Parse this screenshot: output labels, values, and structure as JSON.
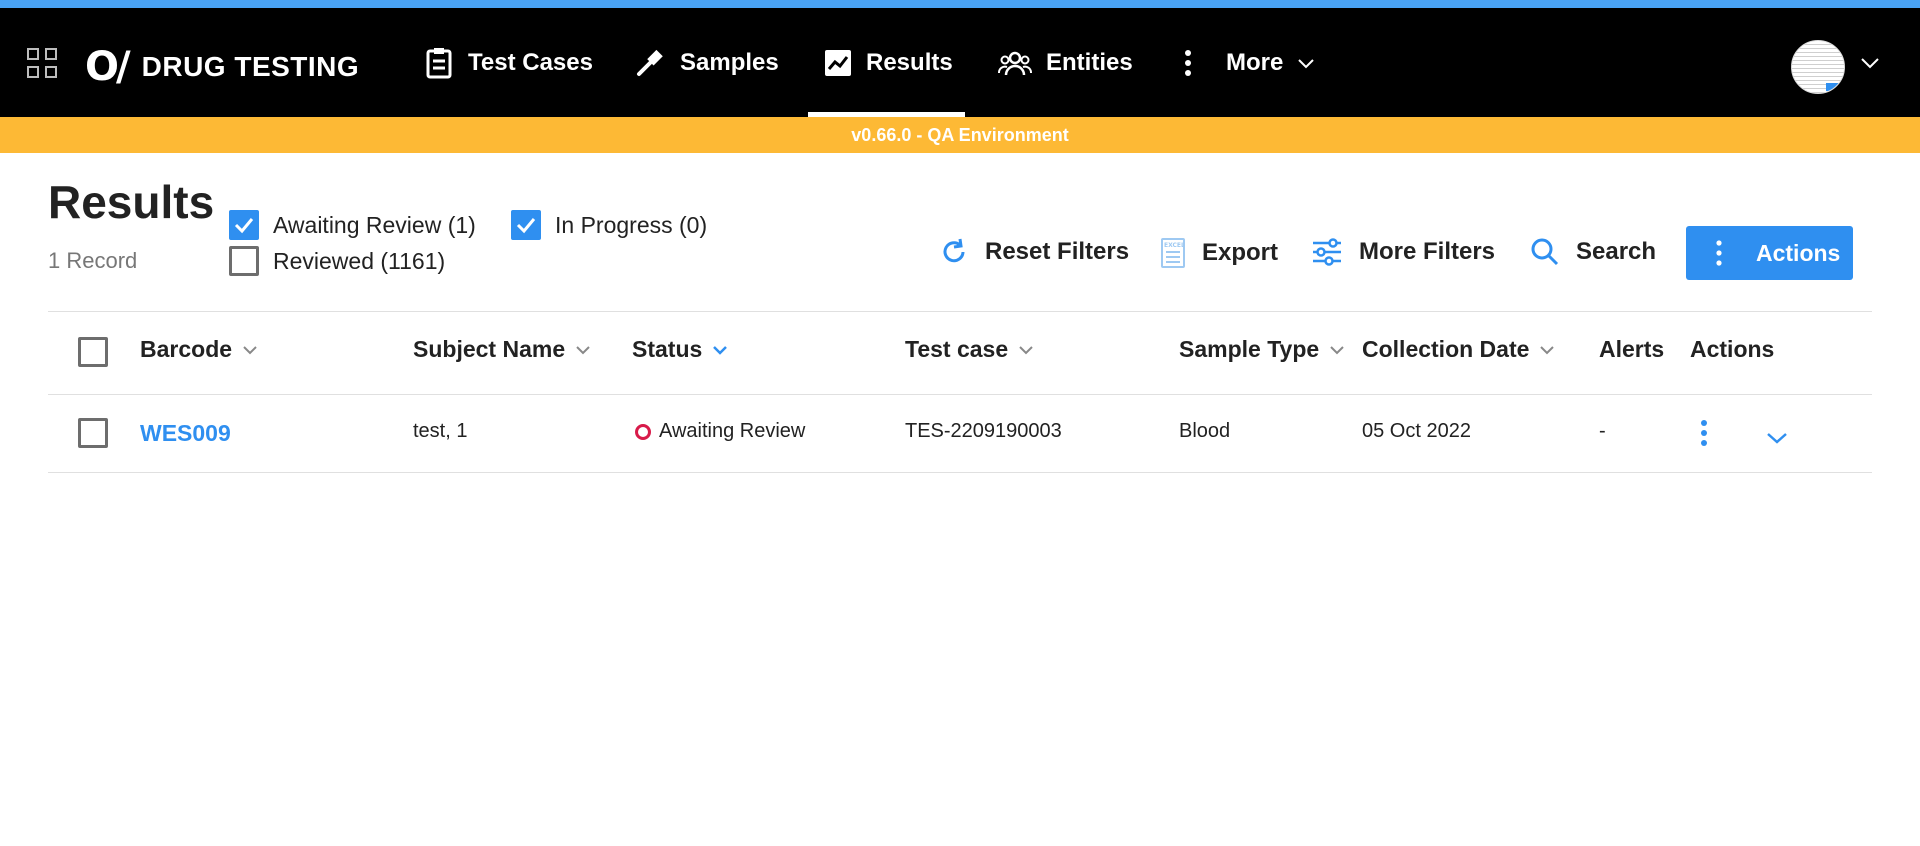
{
  "app": {
    "name": "DRUG TESTING",
    "logo_mark": "O/"
  },
  "nav": {
    "items": [
      {
        "label": "Test Cases",
        "icon": "clipboard-icon"
      },
      {
        "label": "Samples",
        "icon": "pipette-icon"
      },
      {
        "label": "Results",
        "icon": "chart-line-icon",
        "active": true
      },
      {
        "label": "Entities",
        "icon": "people-icon"
      },
      {
        "label": "More",
        "icon": "kebab-icon"
      }
    ]
  },
  "environment": {
    "label": "v0.66.0 - QA Environment"
  },
  "page": {
    "title": "Results",
    "record_count": "1 Record"
  },
  "filters": {
    "awaiting_review": {
      "label": "Awaiting Review (1)",
      "checked": true
    },
    "in_progress": {
      "label": "In Progress (0)",
      "checked": true
    },
    "reviewed": {
      "label": "Reviewed (1161)",
      "checked": false
    }
  },
  "toolbar": {
    "reset_filters": "Reset Filters",
    "export": "Export",
    "export_icon_text": "EXCEL",
    "more_filters": "More Filters",
    "search": "Search",
    "actions": "Actions"
  },
  "table": {
    "columns": [
      "Barcode",
      "Subject Name",
      "Status",
      "Test case",
      "Sample Type",
      "Collection Date",
      "Alerts",
      "Actions"
    ],
    "rows": [
      {
        "barcode": "WES009",
        "subject_name": "test, 1",
        "status": "Awaiting Review",
        "test_case": "TES-2209190003",
        "sample_type": "Blood",
        "collection_date": "05 Oct 2022",
        "alerts": "-"
      }
    ]
  },
  "colors": {
    "accent": "#2f8ff0",
    "env_banner": "#fdb935",
    "nav_bg": "#000000",
    "status_awaiting": "#d81b4a"
  }
}
